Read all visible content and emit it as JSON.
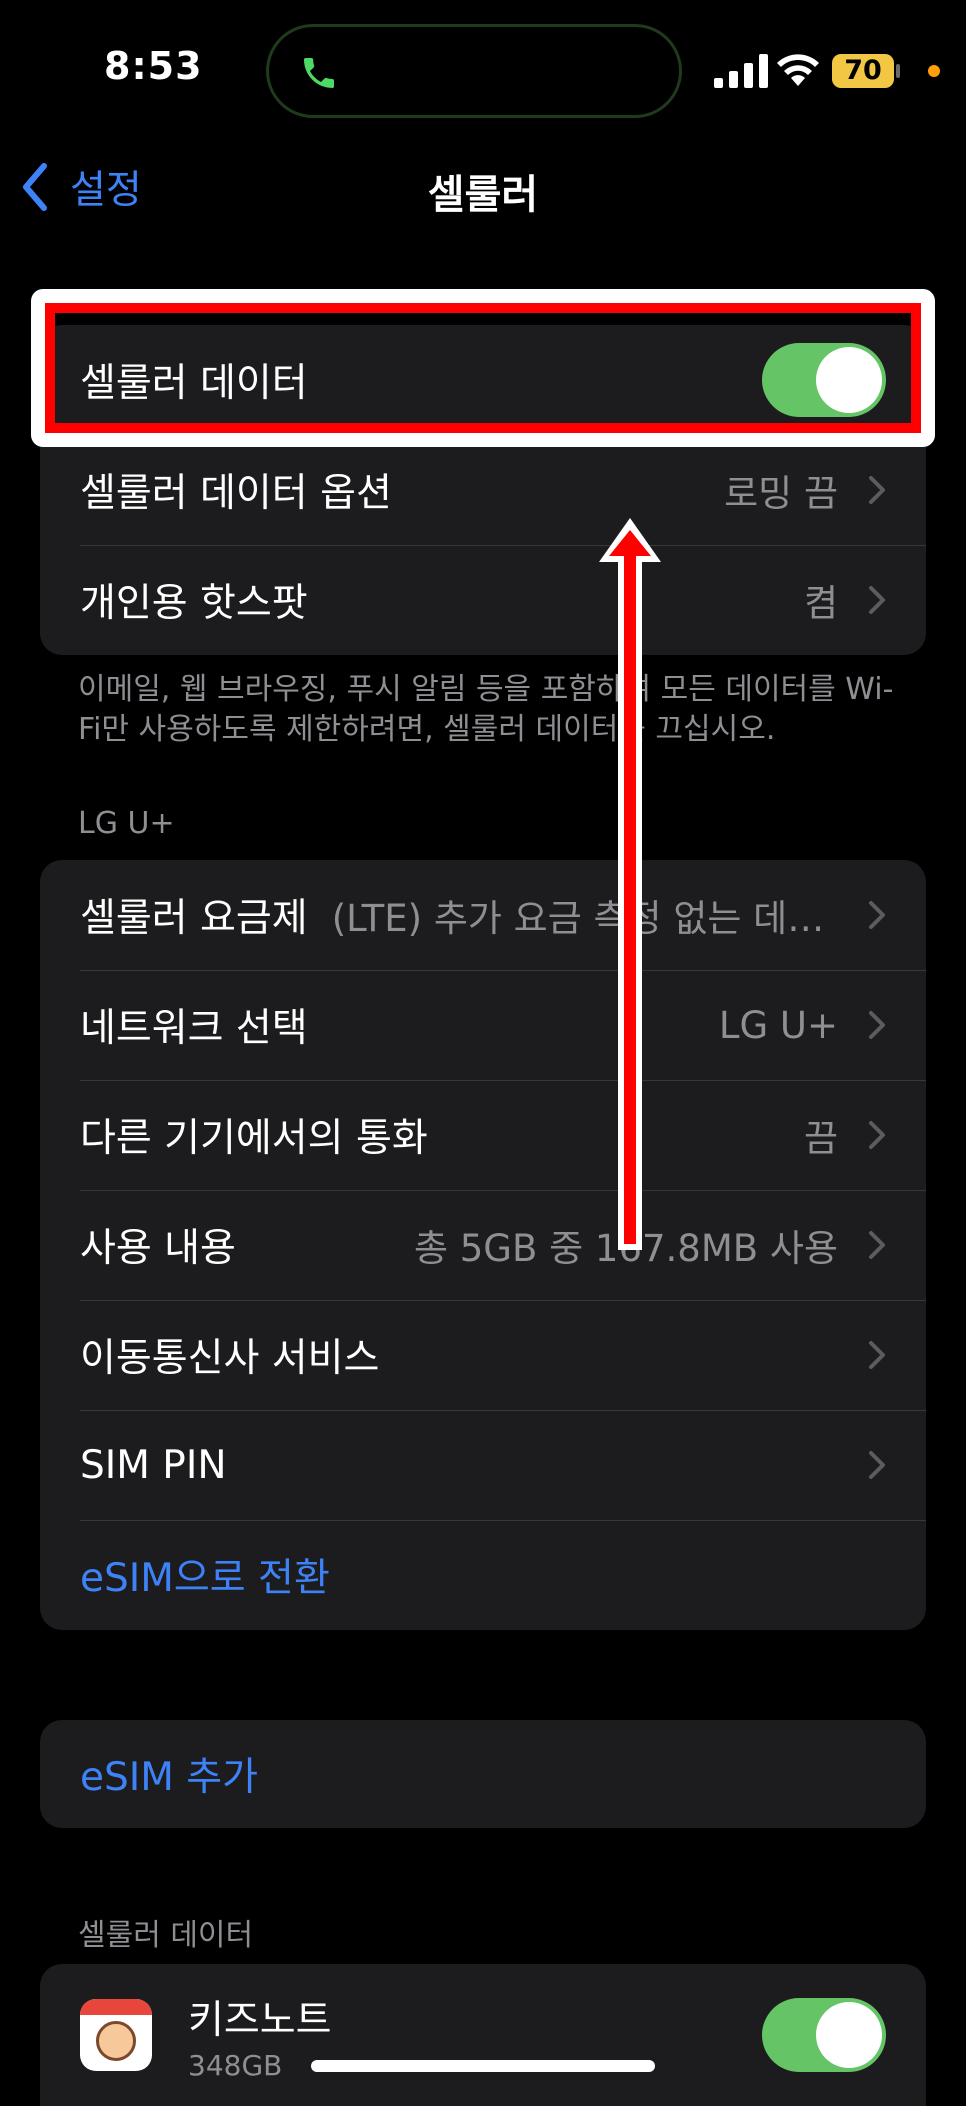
{
  "status": {
    "time": "8:53",
    "battery": "70"
  },
  "nav": {
    "back_label": "설정",
    "title": "셀룰러"
  },
  "main_group": {
    "cellular_data_label": "셀룰러 데이터",
    "options_label": "셀룰러 데이터 옵션",
    "options_value": "로밍 끔",
    "hotspot_label": "개인용 핫스팟",
    "hotspot_value": "켬"
  },
  "footnote": "이메일, 웹 브라우징, 푸시 알림 등을 포함하여 모든 데이터를 Wi-Fi만 사용하도록 제한하려면, 셀룰러 데이터를 끄십시오.",
  "carrier_section": {
    "header": "LG U+",
    "rows": [
      {
        "label": "셀룰러 요금제",
        "value": "(LTE) 추가 요금 측정 없는 데…"
      },
      {
        "label": "네트워크 선택",
        "value": "LG U+"
      },
      {
        "label": "다른 기기에서의 통화",
        "value": "끔"
      },
      {
        "label": "사용 내용",
        "value": "총 5GB 중 167.8MB 사용"
      },
      {
        "label": "이동통신사 서비스",
        "value": ""
      },
      {
        "label": "SIM PIN",
        "value": ""
      }
    ],
    "esim_convert": "eSIM으로 전환"
  },
  "esim_add": "eSIM 추가",
  "app_section": {
    "header": "셀룰러 데이터",
    "apps": [
      {
        "name": "키즈노트",
        "size": "348GB"
      }
    ]
  },
  "colors": {
    "accent": "#3e82f7",
    "toggle_on": "#65c466",
    "annotation": "#ff0000"
  }
}
